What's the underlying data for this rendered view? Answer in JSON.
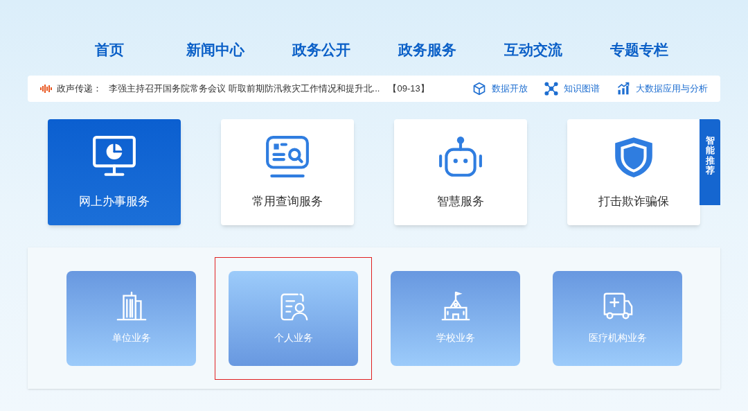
{
  "nav": [
    {
      "label": "首页"
    },
    {
      "label": "新闻中心"
    },
    {
      "label": "政务公开"
    },
    {
      "label": "政务服务"
    },
    {
      "label": "互动交流"
    },
    {
      "label": "专题专栏"
    }
  ],
  "ticker": {
    "label": "政声传递：",
    "headline": "李强主持召开国务院常务会议 听取前期防汛救灾工作情况和提升北...",
    "date": "【09-13】"
  },
  "quick_links": [
    {
      "kind": "cube",
      "label": "数据开放"
    },
    {
      "kind": "graph",
      "label": "知识图谱"
    },
    {
      "kind": "chart",
      "label": "大数据应用与分析"
    }
  ],
  "service_cards": [
    {
      "kind": "monitor",
      "label": "网上办事服务",
      "selected": true
    },
    {
      "kind": "search",
      "label": "常用查询服务",
      "selected": false
    },
    {
      "kind": "robot",
      "label": "智慧服务",
      "selected": false
    },
    {
      "kind": "shield",
      "label": "打击欺诈骗保",
      "selected": false
    }
  ],
  "side_tab": {
    "label": "智能推荐"
  },
  "business_tiles": [
    {
      "kind": "building",
      "label": "单位业务",
      "selected": false
    },
    {
      "kind": "person",
      "label": "个人业务",
      "selected": true
    },
    {
      "kind": "school",
      "label": "学校业务",
      "selected": false
    },
    {
      "kind": "ambulance",
      "label": "医疗机构业务",
      "selected": false
    }
  ]
}
